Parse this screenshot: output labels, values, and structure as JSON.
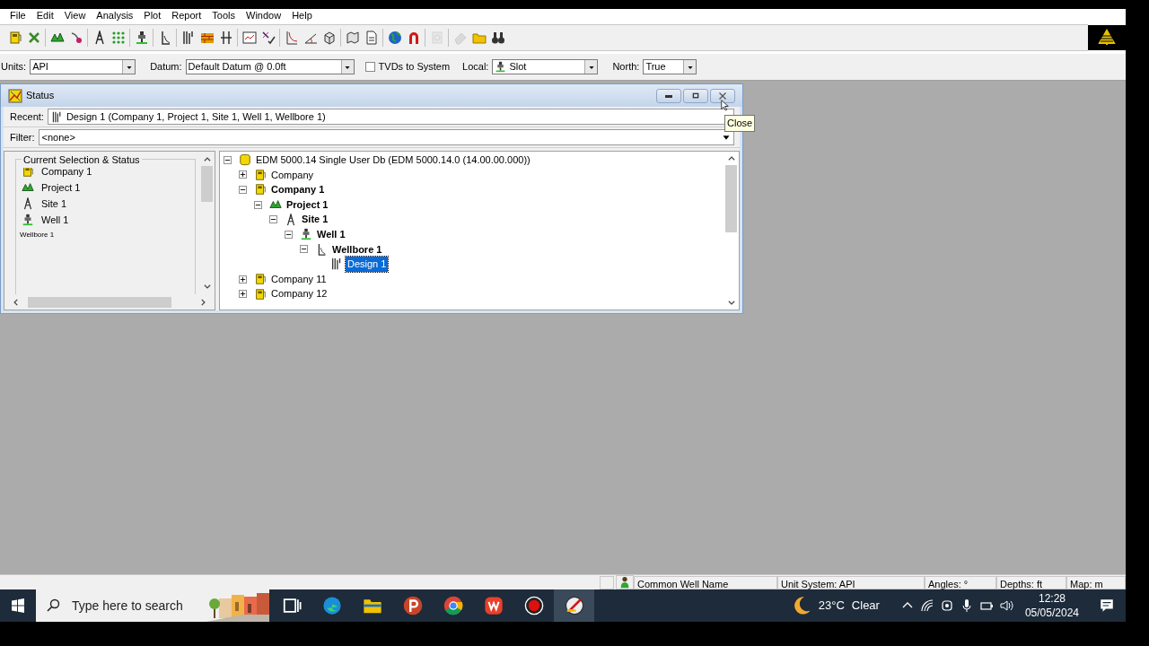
{
  "menu": [
    "File",
    "Edit",
    "View",
    "Analysis",
    "Plot",
    "Report",
    "Tools",
    "Window",
    "Help"
  ],
  "toolbar": [
    {
      "kind": "pump",
      "disabled": false
    },
    {
      "kind": "tools",
      "disabled": false
    },
    {
      "kind": "sep"
    },
    {
      "kind": "project",
      "disabled": false
    },
    {
      "kind": "pin",
      "disabled": false
    },
    {
      "kind": "sep"
    },
    {
      "kind": "site",
      "disabled": false
    },
    {
      "kind": "grid",
      "disabled": false
    },
    {
      "kind": "sep"
    },
    {
      "kind": "well",
      "disabled": false
    },
    {
      "kind": "sep"
    },
    {
      "kind": "wellbore",
      "disabled": false
    },
    {
      "kind": "sep"
    },
    {
      "kind": "design",
      "disabled": false
    },
    {
      "kind": "brick",
      "disabled": false
    },
    {
      "kind": "split",
      "disabled": false
    },
    {
      "kind": "sep"
    },
    {
      "kind": "chart",
      "disabled": false
    },
    {
      "kind": "check",
      "disabled": false
    },
    {
      "kind": "sep"
    },
    {
      "kind": "curve",
      "disabled": false
    },
    {
      "kind": "angle",
      "disabled": false
    },
    {
      "kind": "cube",
      "disabled": false
    },
    {
      "kind": "sep"
    },
    {
      "kind": "map",
      "disabled": false
    },
    {
      "kind": "doc",
      "disabled": false
    },
    {
      "kind": "sep"
    },
    {
      "kind": "globe",
      "disabled": false
    },
    {
      "kind": "magnet",
      "disabled": false
    },
    {
      "kind": "sep"
    },
    {
      "kind": "panel",
      "disabled": true
    },
    {
      "kind": "sep"
    },
    {
      "kind": "eraser",
      "disabled": true
    },
    {
      "kind": "folder",
      "disabled": false
    },
    {
      "kind": "binoculars",
      "disabled": false
    }
  ],
  "options": {
    "units_label": "Units:",
    "units": "API",
    "datum_label": "Datum:",
    "datum": "Default Datum @ 0.0ft",
    "tvd_label": "TVDs to System",
    "tvd_checked": false,
    "local_label": "Local:",
    "local": "Slot",
    "north_label": "North:",
    "north": "True"
  },
  "status_window": {
    "title": "Status",
    "recent_label": "Recent:",
    "recent": "Design 1 (Company 1, Project 1, Site 1, Well 1, Wellbore 1)",
    "filter_label": "Filter:",
    "filter": "<none>",
    "tooltip": "Close",
    "selection_group": "Current Selection & Status",
    "selection": [
      {
        "kind": "company",
        "label": "Company 1"
      },
      {
        "kind": "project",
        "label": "Project 1"
      },
      {
        "kind": "site",
        "label": "Site 1"
      },
      {
        "kind": "well",
        "label": "Well 1"
      },
      {
        "kind": "small",
        "label": "Wellbore 1"
      }
    ],
    "tree": [
      {
        "kind": "database",
        "label": "EDM 5000.14 Single User Db (EDM 5000.14.0 (14.00.00.000))",
        "expanded": true,
        "current": false,
        "selected": false,
        "children": [
          {
            "kind": "company",
            "label": "Company",
            "expanded": false,
            "current": false,
            "selected": false
          },
          {
            "kind": "company",
            "label": "Company 1",
            "expanded": true,
            "current": true,
            "selected": false,
            "children": [
              {
                "kind": "project",
                "label": "Project 1",
                "expanded": true,
                "current": true,
                "selected": false,
                "children": [
                  {
                    "kind": "site",
                    "label": "Site 1",
                    "expanded": true,
                    "current": true,
                    "selected": false,
                    "children": [
                      {
                        "kind": "well",
                        "label": "Well 1",
                        "expanded": true,
                        "current": true,
                        "selected": false,
                        "children": [
                          {
                            "kind": "wellbore",
                            "label": "Wellbore 1",
                            "expanded": true,
                            "current": true,
                            "selected": false,
                            "children": [
                              {
                                "kind": "design",
                                "label": "Design 1",
                                "current": false,
                                "selected": true
                              }
                            ]
                          }
                        ]
                      }
                    ]
                  }
                ]
              }
            ]
          },
          {
            "kind": "company",
            "label": "Company 11",
            "expanded": false,
            "current": false,
            "selected": false
          },
          {
            "kind": "company",
            "label": "Company 12",
            "expanded": false,
            "current": false,
            "selected": false
          }
        ]
      }
    ]
  },
  "status_bar": [
    "Common Well Name",
    "Unit System: API",
    "Angles: °",
    "Depths: ft",
    "Map: m"
  ],
  "taskbar": {
    "search_placeholder": "Type here to search",
    "apps": [
      {
        "kind": "taskview",
        "selected": false
      },
      {
        "kind": "edge",
        "selected": false
      },
      {
        "kind": "files",
        "selected": false
      },
      {
        "kind": "p",
        "selected": false
      },
      {
        "kind": "chrome",
        "selected": false
      },
      {
        "kind": "wps",
        "selected": false
      },
      {
        "kind": "record",
        "selected": false
      },
      {
        "kind": "compass",
        "selected": true
      }
    ],
    "temperature": "23°C",
    "weather": "Clear",
    "time": "12:28",
    "date": "05/05/2024"
  }
}
